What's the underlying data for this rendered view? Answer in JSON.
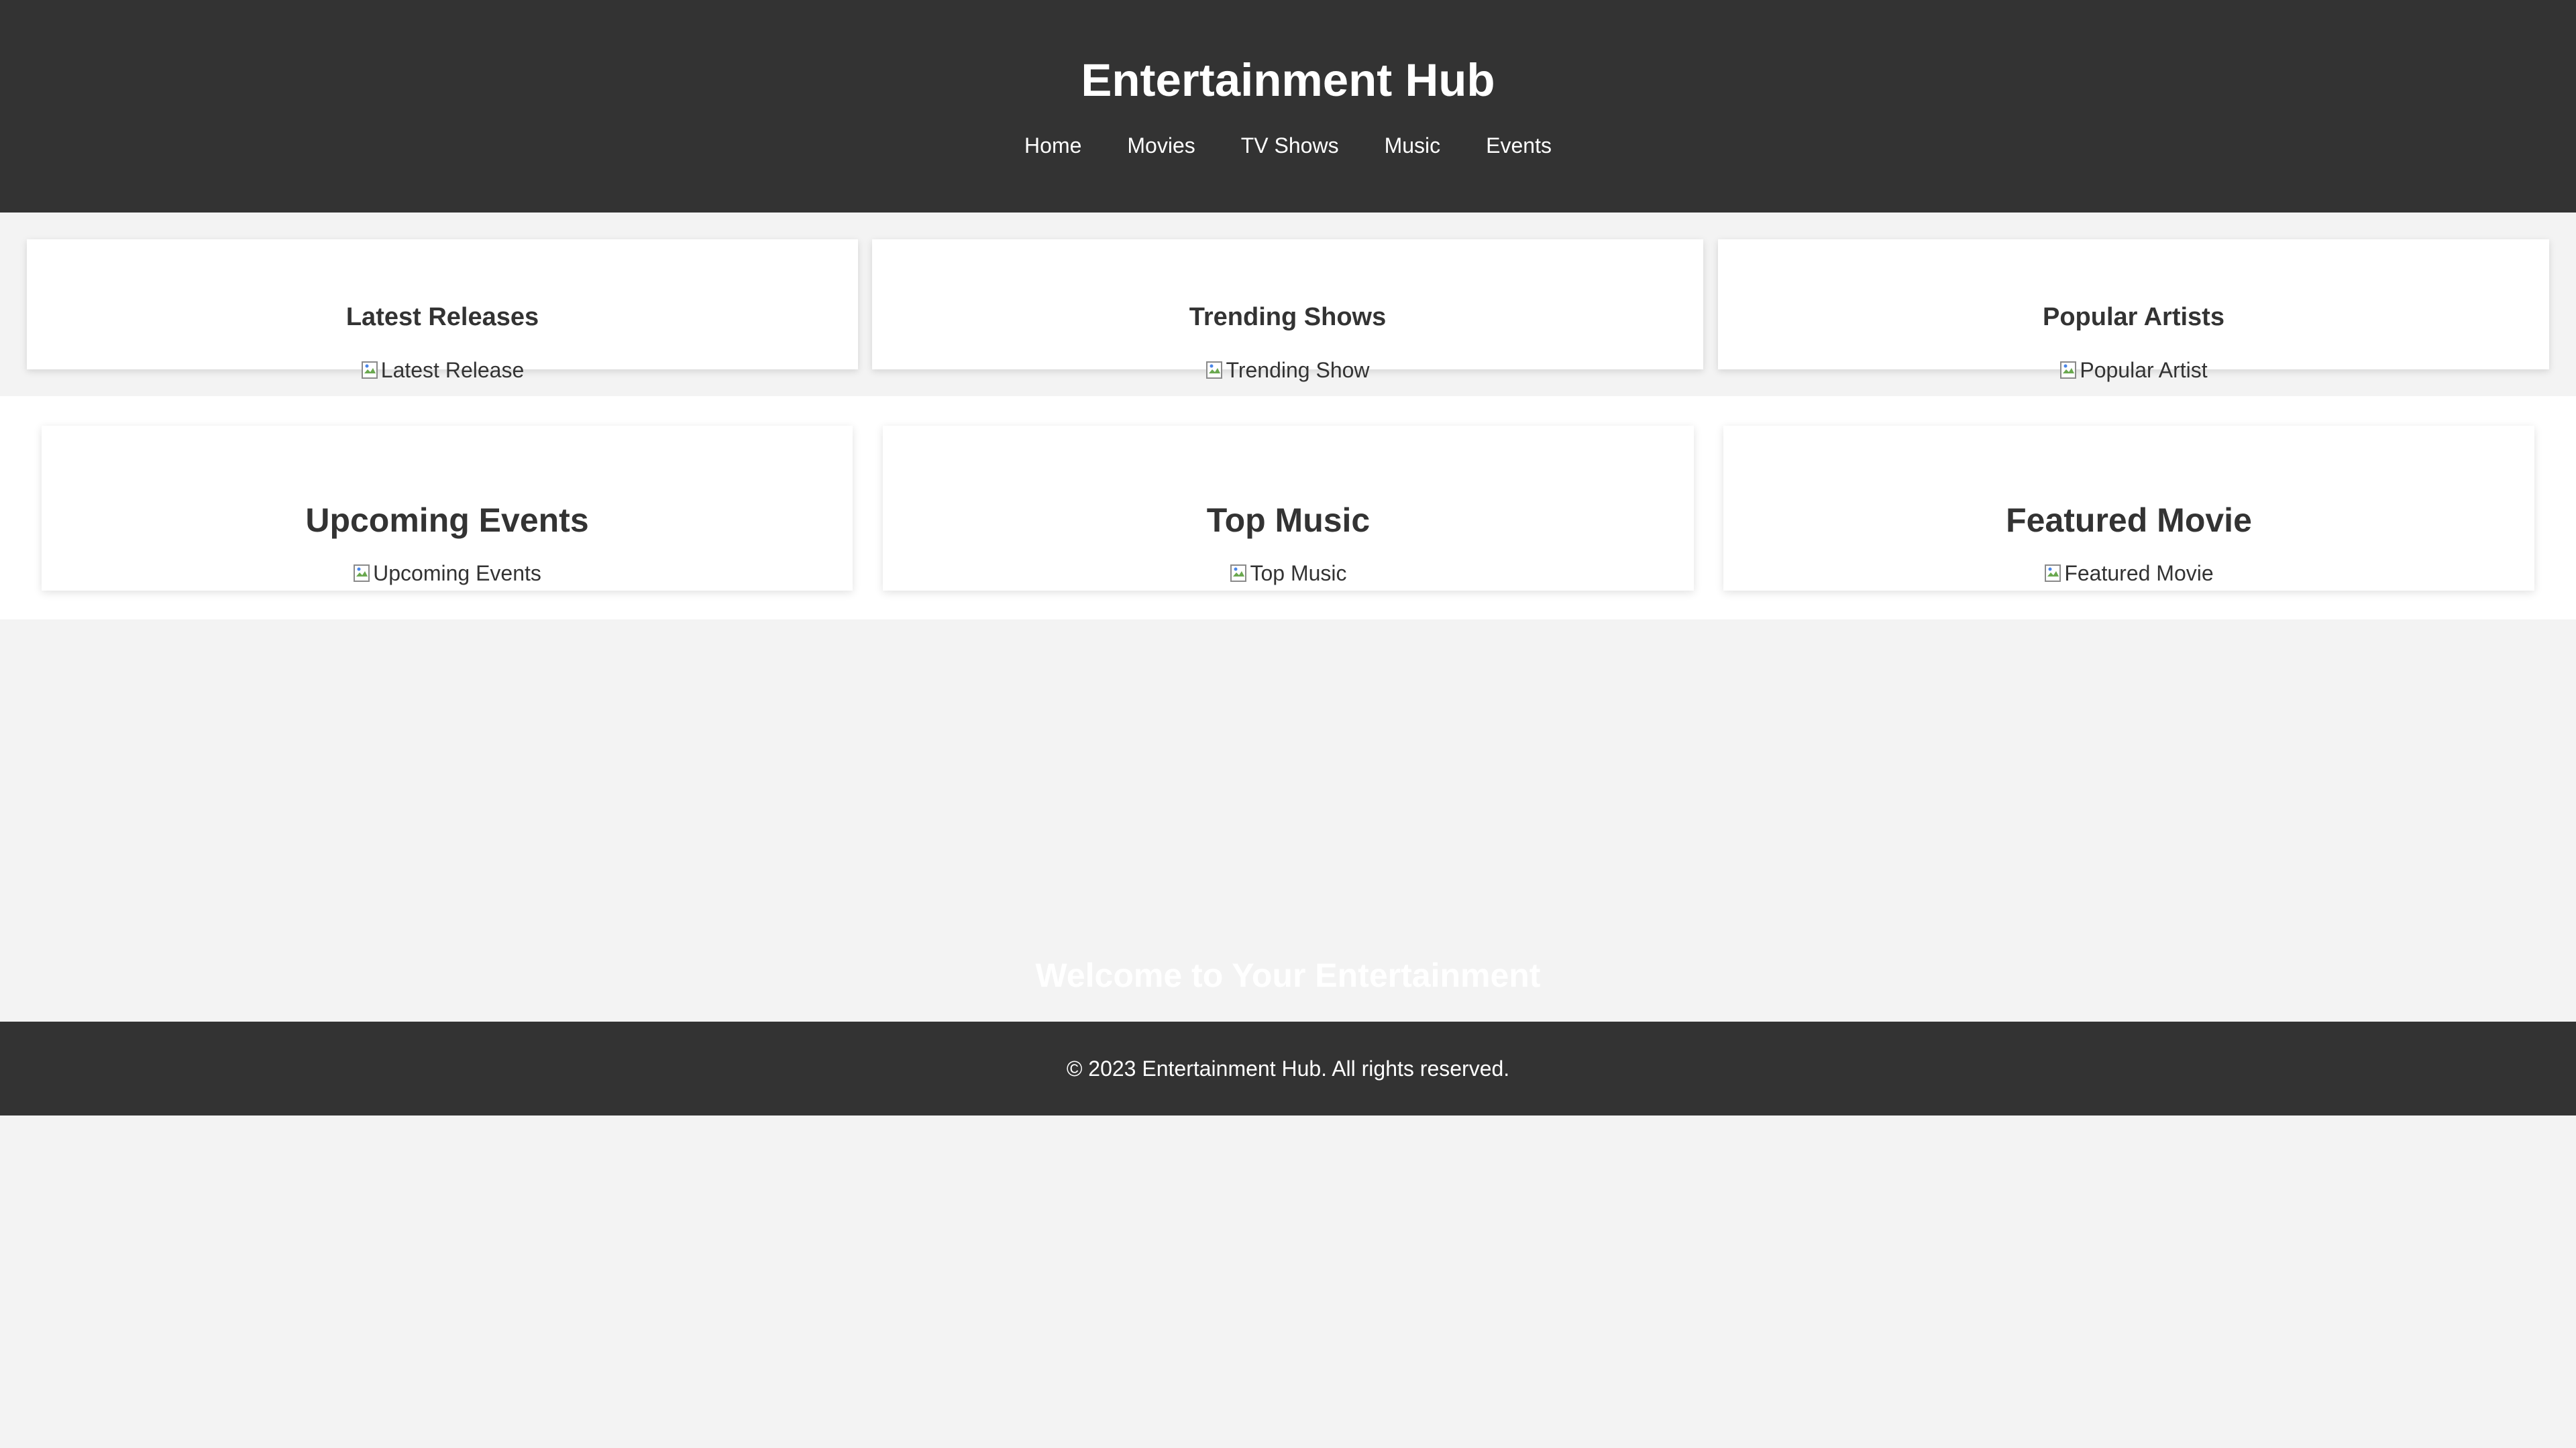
{
  "header": {
    "title": "Entertainment Hub",
    "nav": [
      "Home",
      "Movies",
      "TV Shows",
      "Music",
      "Events"
    ]
  },
  "section_one": {
    "cards": [
      {
        "title": "Latest Releases",
        "image_alt": "Latest Release"
      },
      {
        "title": "Trending Shows",
        "image_alt": "Trending Show"
      },
      {
        "title": "Popular Artists",
        "image_alt": "Popular Artist"
      }
    ]
  },
  "section_two": {
    "cards": [
      {
        "title": "Upcoming Events",
        "image_alt": "Upcoming Events"
      },
      {
        "title": "Top Music",
        "image_alt": "Top Music"
      },
      {
        "title": "Featured Movie",
        "image_alt": "Featured Movie"
      }
    ]
  },
  "hero": {
    "title": "Welcome to Your Entertainment"
  },
  "footer": {
    "text": "© 2023 Entertainment Hub. All rights reserved."
  },
  "colors": {
    "header_bg": "#333333",
    "page_bg": "#f3f3f3",
    "card_bg": "#ffffff",
    "text": "#333333"
  },
  "icons": {
    "broken_image": "broken-image-icon"
  }
}
